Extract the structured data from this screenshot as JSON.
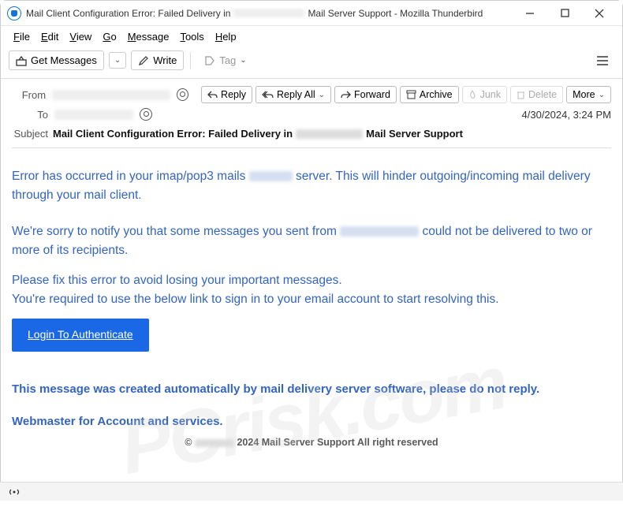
{
  "window": {
    "title_prefix": "Mail Client Configuration Error: Failed Delivery in",
    "title_suffix": "Mail Server Support - Mozilla Thunderbird"
  },
  "menu": {
    "file": "File",
    "edit": "Edit",
    "view": "View",
    "go": "Go",
    "message": "Message",
    "tools": "Tools",
    "help": "Help"
  },
  "toolbar": {
    "get_messages": "Get Messages",
    "write": "Write",
    "tag": "Tag"
  },
  "headers": {
    "from_label": "From",
    "to_label": "To",
    "subject_label": "Subject",
    "subject_prefix": "Mail Client Configuration Error: Failed Delivery in",
    "subject_suffix": "Mail Server Support",
    "date": "4/30/2024, 3:24 PM"
  },
  "actions": {
    "reply": "Reply",
    "reply_all": "Reply All",
    "forward": "Forward",
    "archive": "Archive",
    "junk": "Junk",
    "delete": "Delete",
    "more": "More"
  },
  "body": {
    "p1a": "Error has occurred in your imap/pop3 mails",
    "p1b": "server. This will hinder outgoing/incoming mail delivery through your mail client.",
    "p2a": "We're sorry to notify you that some messages you sent from",
    "p2b": "could not be delivered to two or more of its recipients.",
    "p3": "Please fix this error to avoid losing your important messages.",
    "p4": "You're required to use the below link to sign in to your email account to start resolving this.",
    "button": "Login To Authenticate",
    "footer1": "This message was created automatically by mail delivery server software, please do not reply.",
    "footer2": "Webmaster for Account and services.",
    "copyright_prefix": "©",
    "copyright_suffix": "2024 Mail Server Support All right reserved"
  },
  "status": {
    "indicator": "((○))"
  }
}
